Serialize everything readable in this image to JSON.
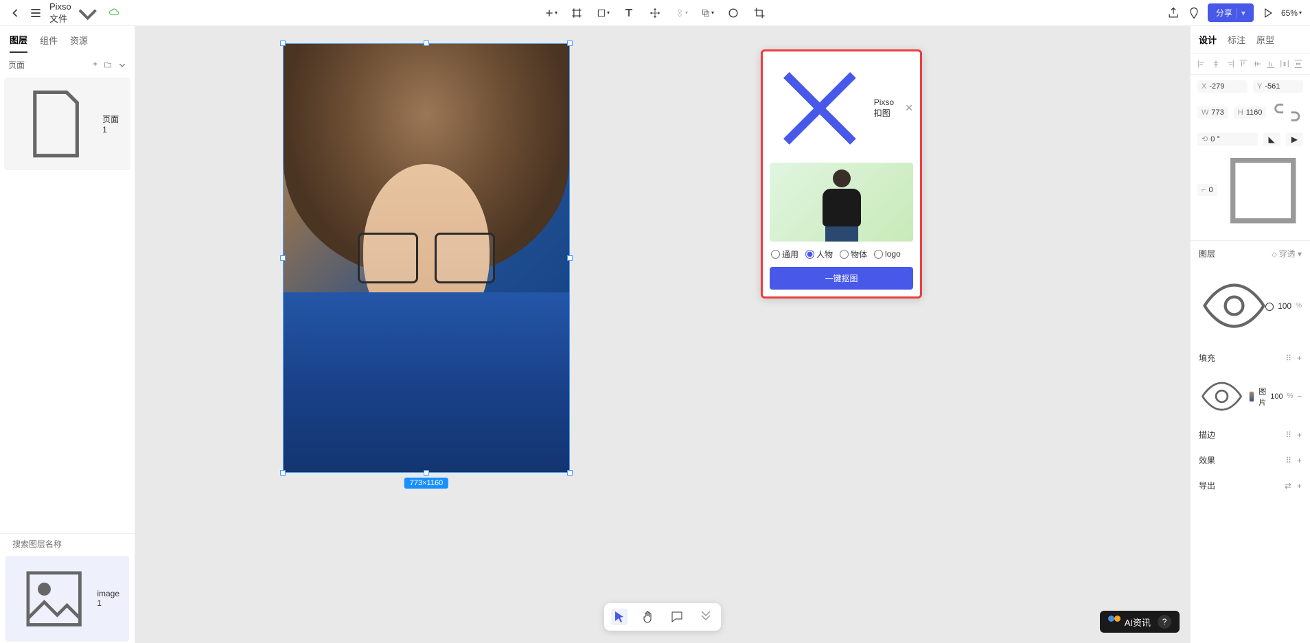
{
  "toolbar": {
    "file_name": "Pixso 文件",
    "share_label": "分享",
    "zoom": "65%"
  },
  "left_panel": {
    "tabs": {
      "layers": "图层",
      "components": "组件",
      "assets": "资源"
    },
    "pages_label": "页面",
    "pages": [
      "页面 1"
    ],
    "search_placeholder": "搜索图层名称",
    "layers": [
      "image 1"
    ]
  },
  "canvas": {
    "dimensions_badge": "773×1160"
  },
  "popup": {
    "title": "Pixso 扣图",
    "options": {
      "general": "通用",
      "person": "人物",
      "object": "物体",
      "logo": "logo"
    },
    "action_button": "一键抠图"
  },
  "right_panel": {
    "tabs": {
      "design": "设计",
      "inspect": "标注",
      "prototype": "原型"
    },
    "position": {
      "x_label": "X",
      "x": "-279",
      "y_label": "Y",
      "y": "-561"
    },
    "size": {
      "w_label": "W",
      "w": "773",
      "h_label": "H",
      "h": "1160"
    },
    "rotation": {
      "label": "0 °"
    },
    "corner": {
      "label": "0"
    },
    "layer_section": "图层",
    "blend_mode": "穿透",
    "opacity": "100",
    "pct": "%",
    "fill_section": "填充",
    "fill_type": "图片",
    "fill_opacity": "100",
    "stroke_section": "描边",
    "effects_section": "效果",
    "export_section": "导出"
  },
  "watermark": {
    "text": "AI资讯",
    "help": "?"
  }
}
